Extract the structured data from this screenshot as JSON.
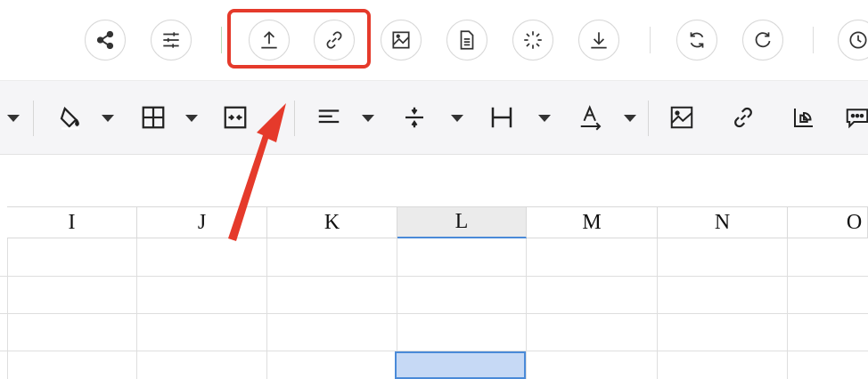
{
  "top_toolbar": {
    "buttons": [
      {
        "name": "share-icon"
      },
      {
        "name": "settings-sliders-icon"
      },
      {
        "name": "upload-icon"
      },
      {
        "name": "link-icon"
      },
      {
        "name": "image-icon"
      },
      {
        "name": "document-icon"
      },
      {
        "name": "loading-icon"
      },
      {
        "name": "download-icon"
      },
      {
        "name": "refresh-icon"
      },
      {
        "name": "redo-icon"
      },
      {
        "name": "history-icon"
      }
    ],
    "highlight_color": "#e53a2b"
  },
  "format_toolbar": {
    "tools": [
      "paint-bucket-icon",
      "borders-icon",
      "merge-cells-icon",
      "align-left-icon",
      "vertical-align-icon",
      "column-width-icon",
      "text-direction-icon",
      "insert-image-icon",
      "insert-link-icon",
      "chart-icon",
      "comment-icon"
    ]
  },
  "sheet": {
    "columns": [
      {
        "label": "I"
      },
      {
        "label": "J"
      },
      {
        "label": "K"
      },
      {
        "label": "L"
      },
      {
        "label": "M"
      },
      {
        "label": "N"
      },
      {
        "label": "O"
      }
    ],
    "active_column": "L",
    "accent_color": "#4a8ad8",
    "selection_fill": "#c6d9f5"
  }
}
